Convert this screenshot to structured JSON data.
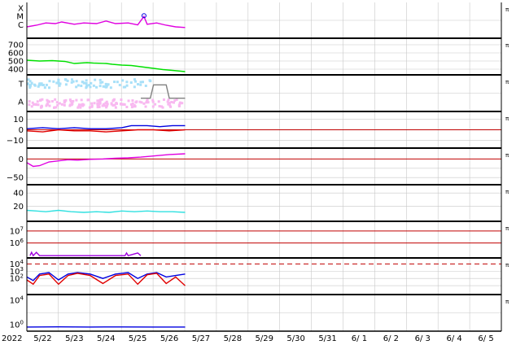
{
  "chart_data": {
    "type": "line",
    "year_label": "2022",
    "x_tick_labels": [
      "5/22",
      "5/23",
      "5/24",
      "5/25",
      "5/26",
      "5/27",
      "5/28",
      "5/29",
      "5/30",
      "5/31",
      "6/ 1",
      "6/ 2",
      "6/ 3",
      "6/ 4",
      "6/ 5"
    ],
    "x_range_days": [
      0,
      15
    ],
    "data_end_day": 5.0,
    "grid": true,
    "colors": {
      "magenta": "#e000e0",
      "green": "#00e000",
      "lightblue": "#a8e0f8",
      "pink": "#f8b8f0",
      "blue": "#0000e0",
      "red": "#e00000",
      "cyan": "#30e0e0",
      "purple": "#a000e0",
      "gray": "#808080"
    },
    "panels": [
      {
        "id": "xray-class",
        "y_tick_labels": [
          "X",
          "M",
          "C"
        ],
        "series": [
          {
            "color": "#e000e0",
            "points": [
              [
                0,
                0.3
              ],
              [
                0.3,
                0.35
              ],
              [
                0.6,
                0.42
              ],
              [
                0.9,
                0.4
              ],
              [
                1.1,
                0.45
              ],
              [
                1.5,
                0.38
              ],
              [
                1.8,
                0.42
              ],
              [
                2.2,
                0.4
              ],
              [
                2.5,
                0.48
              ],
              [
                2.8,
                0.4
              ],
              [
                3.2,
                0.42
              ],
              [
                3.5,
                0.36
              ],
              [
                3.7,
                0.62
              ],
              [
                3.8,
                0.38
              ],
              [
                4.1,
                0.42
              ],
              [
                4.4,
                0.35
              ],
              [
                4.7,
                0.3
              ],
              [
                5.0,
                0.28
              ]
            ]
          }
        ]
      },
      {
        "id": "solar-wind-speed",
        "y_tick_labels": [
          "700",
          "600",
          "500",
          "400"
        ],
        "series": [
          {
            "color": "#00e000",
            "points": [
              [
                0,
                510
              ],
              [
                0.4,
                500
              ],
              [
                0.8,
                505
              ],
              [
                1.2,
                495
              ],
              [
                1.5,
                470
              ],
              [
                1.9,
                480
              ],
              [
                2.1,
                475
              ],
              [
                2.5,
                470
              ],
              [
                2.7,
                460
              ],
              [
                3.0,
                450
              ],
              [
                3.3,
                445
              ],
              [
                3.6,
                430
              ],
              [
                4.0,
                410
              ],
              [
                4.3,
                395
              ],
              [
                4.6,
                385
              ],
              [
                5.0,
                370
              ]
            ]
          }
        ]
      },
      {
        "id": "magnetic-sector",
        "y_tick_labels": [
          "T",
          "A"
        ],
        "series": [
          {
            "color": "#808080",
            "points": [
              [
                3.6,
                0.35
              ],
              [
                3.9,
                0.35
              ],
              [
                4.0,
                0.75
              ],
              [
                4.4,
                0.75
              ],
              [
                4.5,
                0.35
              ],
              [
                5.0,
                0.35
              ]
            ]
          }
        ]
      },
      {
        "id": "imf-components",
        "y_tick_labels": [
          "10",
          "0",
          "−10"
        ],
        "series": [
          {
            "color": "#0000e0",
            "points": [
              [
                0,
                1
              ],
              [
                0.5,
                2
              ],
              [
                1.0,
                1
              ],
              [
                1.5,
                2
              ],
              [
                2.0,
                1
              ],
              [
                2.5,
                1
              ],
              [
                3.0,
                2
              ],
              [
                3.3,
                4
              ],
              [
                3.8,
                4
              ],
              [
                4.2,
                3
              ],
              [
                4.6,
                4
              ],
              [
                5.0,
                4
              ]
            ]
          },
          {
            "color": "#e00000",
            "points": [
              [
                0,
                -1
              ],
              [
                0.5,
                -2
              ],
              [
                1.0,
                0
              ],
              [
                1.5,
                -1
              ],
              [
                2.0,
                -1
              ],
              [
                2.5,
                -2
              ],
              [
                3.0,
                -1
              ],
              [
                3.5,
                0
              ],
              [
                4.0,
                0
              ],
              [
                4.5,
                -1
              ],
              [
                5.0,
                0
              ]
            ]
          }
        ]
      },
      {
        "id": "dst-index",
        "y_tick_labels": [
          "0",
          "−50"
        ],
        "series": [
          {
            "color": "#e000e0",
            "points": [
              [
                0,
                -10
              ],
              [
                0.2,
                -20
              ],
              [
                0.4,
                -18
              ],
              [
                0.7,
                -8
              ],
              [
                1.0,
                -5
              ],
              [
                1.3,
                -2
              ],
              [
                1.6,
                -3
              ],
              [
                2.0,
                -1
              ],
              [
                2.4,
                0
              ],
              [
                2.8,
                2
              ],
              [
                3.2,
                3
              ],
              [
                3.6,
                5
              ],
              [
                4.0,
                8
              ],
              [
                4.5,
                12
              ],
              [
                5.0,
                14
              ]
            ]
          }
        ]
      },
      {
        "id": "kp-index",
        "y_tick_labels": [
          "40",
          "20"
        ],
        "series": [
          {
            "color": "#30e0e0",
            "points": [
              [
                0,
                14
              ],
              [
                0.3,
                13
              ],
              [
                0.6,
                12
              ],
              [
                1.0,
                14
              ],
              [
                1.4,
                12
              ],
              [
                1.8,
                11
              ],
              [
                2.2,
                12
              ],
              [
                2.6,
                11
              ],
              [
                3.0,
                13
              ],
              [
                3.4,
                12
              ],
              [
                3.8,
                13
              ],
              [
                4.2,
                12
              ],
              [
                4.6,
                12
              ],
              [
                5.0,
                11
              ]
            ]
          }
        ]
      },
      {
        "id": "proton-flux",
        "y_tick_labels": [
          "10^7",
          "10^6"
        ],
        "series": [
          {
            "color": "#a000e0",
            "points": [
              [
                0.1,
                0.02
              ],
              [
                0.15,
                0.12
              ],
              [
                0.2,
                0.02
              ],
              [
                0.3,
                0.12
              ],
              [
                0.4,
                0.02
              ],
              [
                3.1,
                0.02
              ],
              [
                3.15,
                0.1
              ],
              [
                3.2,
                0.02
              ],
              [
                3.5,
                0.1
              ],
              [
                3.6,
                0.02
              ]
            ]
          }
        ]
      },
      {
        "id": "electron-flux",
        "y_tick_labels": [
          "10^4",
          "10^3",
          "10^2"
        ],
        "series": [
          {
            "color": "#0000e0",
            "points": [
              [
                0,
                2.2
              ],
              [
                0.2,
                1.7
              ],
              [
                0.4,
                2.6
              ],
              [
                0.7,
                2.8
              ],
              [
                1.0,
                1.8
              ],
              [
                1.3,
                2.6
              ],
              [
                1.6,
                2.8
              ],
              [
                2.0,
                2.6
              ],
              [
                2.4,
                2.0
              ],
              [
                2.8,
                2.6
              ],
              [
                3.2,
                2.8
              ],
              [
                3.5,
                2.0
              ],
              [
                3.8,
                2.6
              ],
              [
                4.1,
                2.8
              ],
              [
                4.4,
                2.2
              ],
              [
                4.7,
                2.4
              ],
              [
                5.0,
                2.6
              ]
            ]
          },
          {
            "color": "#e00000",
            "points": [
              [
                0,
                1.8
              ],
              [
                0.2,
                1.2
              ],
              [
                0.4,
                2.4
              ],
              [
                0.7,
                2.6
              ],
              [
                1.0,
                1.2
              ],
              [
                1.3,
                2.4
              ],
              [
                1.6,
                2.7
              ],
              [
                2.0,
                2.4
              ],
              [
                2.4,
                1.3
              ],
              [
                2.8,
                2.4
              ],
              [
                3.2,
                2.6
              ],
              [
                3.5,
                1.2
              ],
              [
                3.8,
                2.5
              ],
              [
                4.1,
                2.7
              ],
              [
                4.4,
                1.3
              ],
              [
                4.7,
                2.2
              ],
              [
                5.0,
                1.0
              ]
            ]
          }
        ]
      },
      {
        "id": "low-energy-flux",
        "y_tick_labels": [
          "10^4",
          "10^0"
        ],
        "series": [
          {
            "color": "#0000e0",
            "points": [
              [
                0,
                0.3
              ],
              [
                1,
                0.32
              ],
              [
                2,
                0.3
              ],
              [
                3,
                0.31
              ],
              [
                4,
                0.3
              ],
              [
                5,
                0.3
              ]
            ]
          }
        ]
      }
    ]
  }
}
